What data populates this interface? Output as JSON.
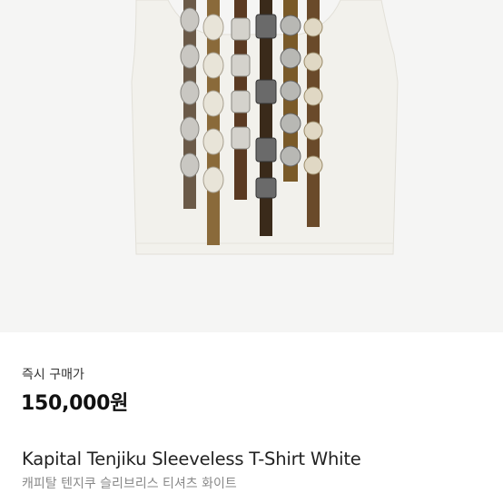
{
  "product": {
    "image_alt": "Kapital Tenjiku Sleeveless T-Shirt White",
    "price_label": "즉시 구매가",
    "price_value": "150,000원",
    "title_en": "Kapital Tenjiku Sleeveless T-Shirt White",
    "title_ko": "캐피탈 텐지쿠 슬리브리스 티셔츠 화이트"
  },
  "colors": {
    "image_background": "#f5f5f4",
    "shirt": "#f2f1ec",
    "price": "#111111",
    "subtitle": "#888888"
  }
}
